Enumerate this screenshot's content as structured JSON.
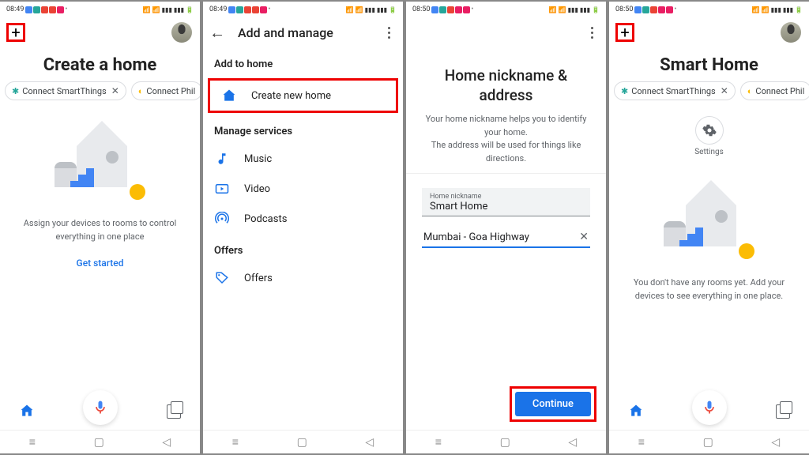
{
  "status": {
    "time1": "08:49",
    "time2": "08:49",
    "time3": "08:50",
    "time4": "08:50"
  },
  "s1": {
    "title": "Create a home",
    "chips": [
      "Connect SmartThings",
      "Connect Phil"
    ],
    "helper1": "Assign your devices to rooms to control",
    "helper2": "everything in one place",
    "get_started": "Get started"
  },
  "s2": {
    "title": "Add and manage",
    "sec1": "Add to home",
    "item_create": "Create new home",
    "sec2": "Manage services",
    "item_music": "Music",
    "item_video": "Video",
    "item_podcasts": "Podcasts",
    "sec3": "Offers",
    "item_offers": "Offers"
  },
  "s3": {
    "title": "Home nickname & address",
    "help1": "Your home nickname helps you to identify your home.",
    "help2": "The address will be used for things like directions.",
    "nick_lbl": "Home nickname",
    "nick_val": "Smart Home",
    "addr_val": "Mumbai - Goa Highway",
    "continue": "Continue"
  },
  "s4": {
    "title": "Smart Home",
    "chips": [
      "Connect SmartThings",
      "Connect Phil"
    ],
    "settings": "Settings",
    "helper1": "You don't have any rooms yet. Add your",
    "helper2": "devices to see everything in one place."
  }
}
